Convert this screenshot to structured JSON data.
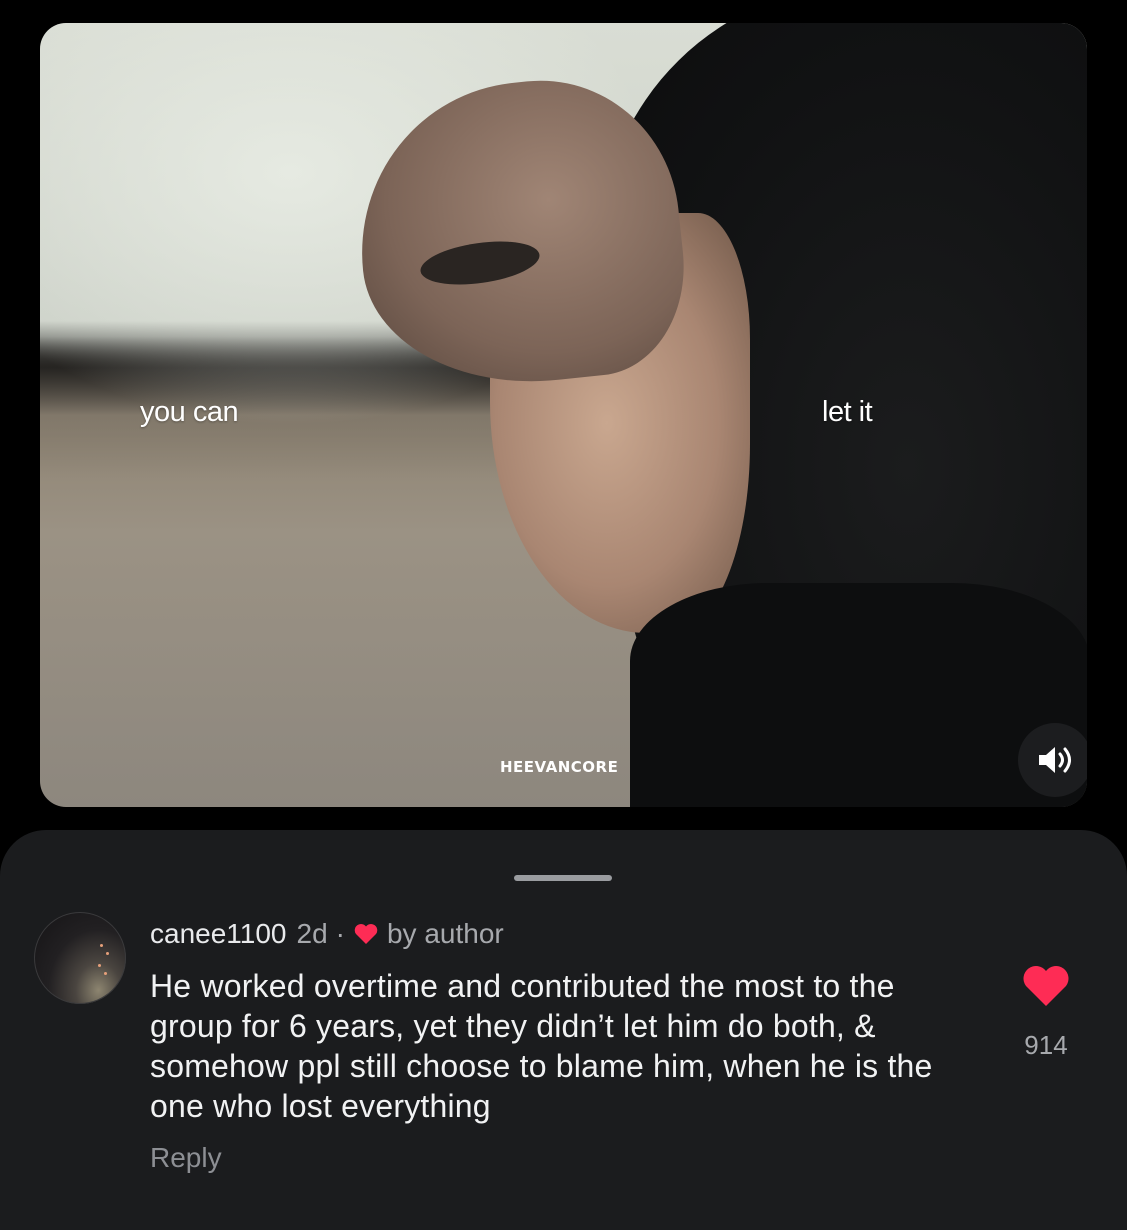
{
  "video": {
    "caption_left": "you can",
    "caption_right": "let it",
    "watermark": "HEEVANCORE",
    "sound_icon": "speaker-volume-icon"
  },
  "comment_sheet": {
    "username": "canee1100",
    "age": "2d",
    "separator": "·",
    "author_badge": "by author",
    "text": "He worked overtime and contributed the most to the group for 6 years, yet they didn’t let him do both, & somehow ppl still choose to blame him, when he is the one who lost everything",
    "reply_label": "Reply",
    "like_count": "914",
    "like_icon": "heart-icon",
    "colors": {
      "heart": "#fe2c55",
      "sheet_bg": "#1b1c1e"
    }
  }
}
